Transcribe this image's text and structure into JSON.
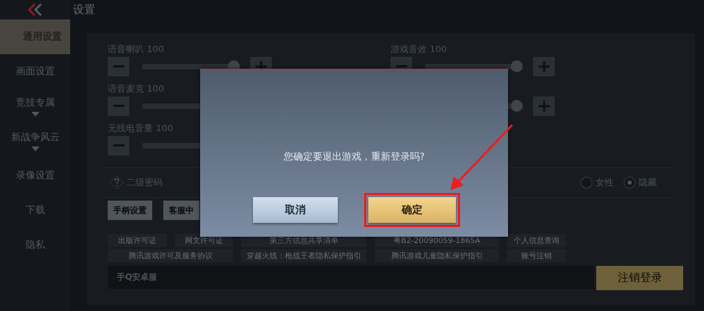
{
  "header": {
    "title": "设置"
  },
  "sidebar": {
    "items": [
      {
        "label": "通用设置",
        "selected": true,
        "has_submenu": false
      },
      {
        "label": "画面设置",
        "selected": false,
        "has_submenu": false
      },
      {
        "label": "竞技专属",
        "selected": false,
        "has_submenu": true
      },
      {
        "label": "新战争风云",
        "selected": false,
        "has_submenu": true
      },
      {
        "label": "录像设置",
        "selected": false,
        "has_submenu": false
      },
      {
        "label": "下载",
        "selected": false,
        "has_submenu": false
      },
      {
        "label": "隐私",
        "selected": false,
        "has_submenu": false
      }
    ]
  },
  "sliders": {
    "left": [
      {
        "label": "语音喇叭",
        "value": "100",
        "level": 1
      },
      {
        "label": "语音麦克",
        "value": "100",
        "level": 1,
        "clipped": true
      },
      {
        "label": "无线电音量",
        "value": "100",
        "level": 1,
        "clipped": true
      }
    ],
    "right": [
      {
        "label": "游戏音效",
        "value": "100",
        "level": 1
      },
      {
        "level": 1,
        "clipped": true
      }
    ]
  },
  "password": {
    "label": "二级密码"
  },
  "gender_options": [
    {
      "label": "女性",
      "selected": false
    },
    {
      "label": "隐藏",
      "selected": true
    }
  ],
  "buttons": [
    "手柄设置",
    "客服中"
  ],
  "links": [
    [
      "出版许可证",
      "网文许可证",
      "第三方信息共享清单",
      "粤B2-20090059-1865A",
      "个人信息查询"
    ],
    [
      "腾讯游戏许可及服务协议",
      "穿越火线：枪战王者隐私保护指引",
      "腾讯游戏儿童隐私保护指引",
      "账号注销"
    ]
  ],
  "account": {
    "server": "手Q安卓服"
  },
  "logout_button": "注销登录",
  "dialog": {
    "message": "您确定要退出游戏，重新登录吗?",
    "buttons": [
      {
        "label": "取消",
        "kind": "secondary",
        "highlighted": false
      },
      {
        "label": "确定",
        "kind": "primary",
        "highlighted": true
      }
    ]
  }
}
